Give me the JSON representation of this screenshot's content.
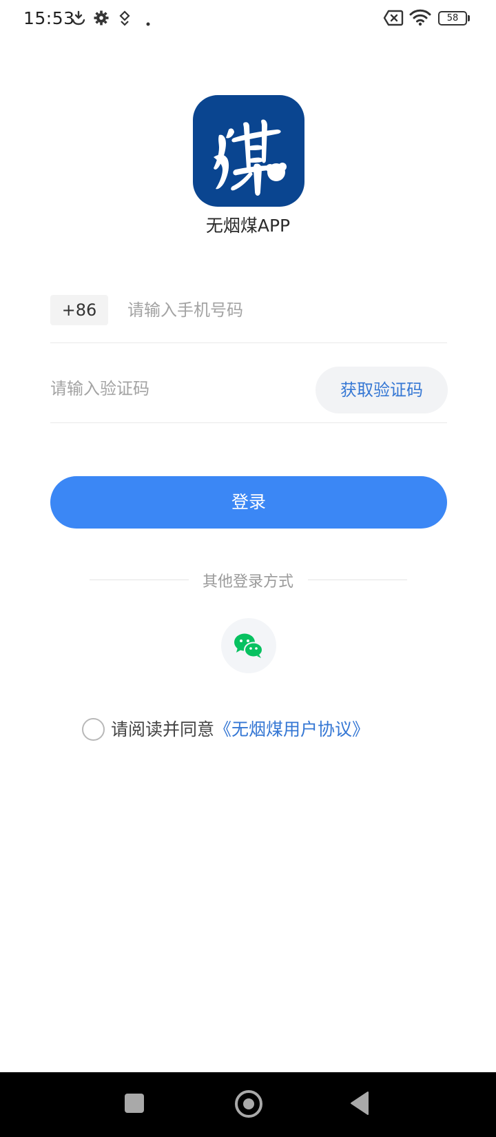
{
  "status_bar": {
    "time": "15:53",
    "battery": "58",
    "icons": [
      "download-icon",
      "gear-icon",
      "location-icon",
      "dot-icon",
      "no-sim-icon",
      "wifi-icon",
      "battery-icon"
    ]
  },
  "app": {
    "logo_icon": "coal-character-logo-icon",
    "name": "无烟煤APP"
  },
  "login_form": {
    "country_code": "+86",
    "phone_placeholder": "请输入手机号码",
    "phone_value": "",
    "code_placeholder": "请输入验证码",
    "code_value": "",
    "get_code_label": "获取验证码",
    "login_label": "登录"
  },
  "other_login": {
    "label": "其他登录方式",
    "wechat_icon": "wechat-icon"
  },
  "agreement": {
    "prefix": "请阅读并同意",
    "link": "《无烟煤用户协议》",
    "checked": false
  },
  "colors": {
    "accent": "#3b87f5",
    "link": "#3577d4",
    "logo_bg": "#0a4590",
    "wechat": "#07c160"
  }
}
